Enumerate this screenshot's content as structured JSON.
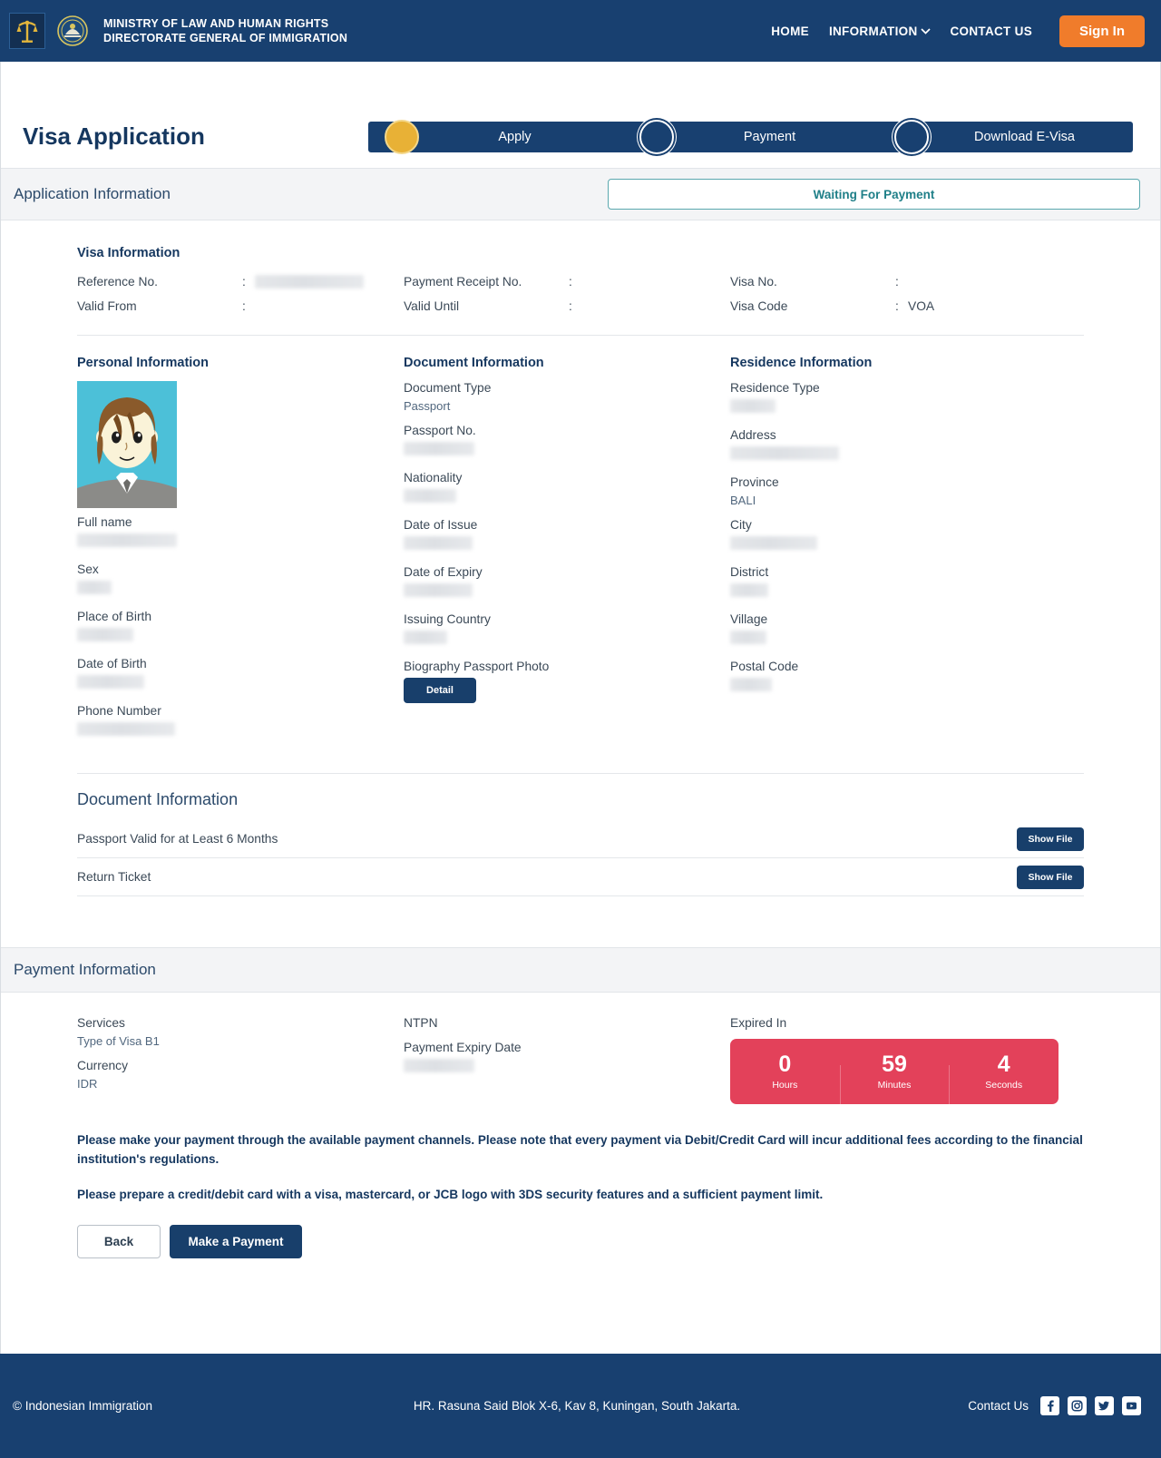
{
  "header": {
    "ministry_line1": "MINISTRY OF  LAW  AND HUMAN RIGHTS",
    "ministry_line2": "DIRECTORATE GENERAL OF IMMIGRATION",
    "nav": [
      {
        "label": "HOME"
      },
      {
        "label": "INFORMATION"
      },
      {
        "label": "CONTACT US"
      }
    ],
    "signin_label": "Sign In",
    "brand_color": "#184070",
    "accent_color": "#f07c2b"
  },
  "page_title": "Visa Application",
  "stepper": {
    "steps": [
      {
        "label": "Apply",
        "state": "active"
      },
      {
        "label": "Payment",
        "state": "inactive"
      },
      {
        "label": "Download E-Visa",
        "state": "inactive"
      }
    ],
    "active_color": "#e8b136"
  },
  "application_section": {
    "title": "Application Information",
    "status": "Waiting For Payment",
    "status_color": "#1f7f88"
  },
  "visa_information": {
    "heading": "Visa Information",
    "rows": [
      {
        "label": "Reference No.",
        "colon": ":",
        "value": "",
        "redacted": true,
        "redact_width": 120
      },
      {
        "label": "Payment Receipt No.",
        "colon": ":",
        "value": "",
        "redacted": false
      },
      {
        "label": "Visa No.",
        "colon": ":",
        "value": "",
        "redacted": false
      },
      {
        "label": "Valid From",
        "colon": ":",
        "value": "",
        "redacted": false
      },
      {
        "label": "Valid Until",
        "colon": ":",
        "value": "",
        "redacted": false
      },
      {
        "label": "Visa Code",
        "colon": ":",
        "value": "VOA",
        "redacted": false
      }
    ]
  },
  "personal_information": {
    "heading": "Personal Information",
    "fields": [
      {
        "label": "Full name",
        "value": "",
        "redacted": true,
        "redact_width": 110
      },
      {
        "label": "Sex",
        "value": "",
        "redacted": true,
        "redact_width": 38
      },
      {
        "label": "Place of Birth",
        "value": "",
        "redacted": true,
        "redact_width": 62
      },
      {
        "label": "Date of Birth",
        "value": "",
        "redacted": true,
        "redact_width": 74
      },
      {
        "label": "Phone Number",
        "value": "",
        "redacted": true,
        "redact_width": 108
      }
    ]
  },
  "document_information": {
    "heading": "Document Information",
    "fields": [
      {
        "label": "Document Type",
        "value": "Passport",
        "redacted": false
      },
      {
        "label": "Passport No.",
        "value": "",
        "redacted": true,
        "redact_width": 78
      },
      {
        "label": "Nationality",
        "value": "",
        "redacted": true,
        "redact_width": 58
      },
      {
        "label": "Date of Issue",
        "value": "",
        "redacted": true,
        "redact_width": 76
      },
      {
        "label": "Date of Expiry",
        "value": "",
        "redacted": true,
        "redact_width": 76
      },
      {
        "label": "Issuing Country",
        "value": "",
        "redacted": true,
        "redact_width": 48
      },
      {
        "label": "Biography Passport Photo",
        "value": "",
        "redacted": false
      }
    ],
    "detail_button": "Detail"
  },
  "residence_information": {
    "heading": "Residence Information",
    "fields": [
      {
        "label": "Residence Type",
        "value": "",
        "redacted": true,
        "redact_width": 50
      },
      {
        "label": "Address",
        "value": "",
        "redacted": true,
        "redact_width": 120
      },
      {
        "label": "Province",
        "value": "BALI",
        "redacted": false
      },
      {
        "label": "City",
        "value": "",
        "redacted": true,
        "redact_width": 96
      },
      {
        "label": "District",
        "value": "",
        "redacted": true,
        "redact_width": 42
      },
      {
        "label": "Village",
        "value": "",
        "redacted": true,
        "redact_width": 40
      },
      {
        "label": "Postal Code",
        "value": "",
        "redacted": true,
        "redact_width": 46
      }
    ]
  },
  "documents_list": {
    "title": "Document Information",
    "rows": [
      {
        "label": "Passport Valid for at Least 6 Months",
        "button": "Show File"
      },
      {
        "label": "Return Ticket",
        "button": "Show File"
      }
    ]
  },
  "payment_information": {
    "title": "Payment Information",
    "fields": [
      {
        "label": "Services",
        "value": "Type of Visa B1",
        "redacted": false
      },
      {
        "label": "Currency",
        "value": "IDR",
        "redacted": false
      },
      {
        "label": "NTPN",
        "value": "",
        "redacted": false
      },
      {
        "label": "Payment Expiry Date",
        "value": "",
        "redacted": true,
        "redact_width": 78
      }
    ],
    "timer": {
      "label": "Expired In",
      "background_color": "#e3415a",
      "units": [
        {
          "value": "0",
          "unit": "Hours"
        },
        {
          "value": "59",
          "unit": "Minutes"
        },
        {
          "value": "4",
          "unit": "Seconds"
        }
      ]
    },
    "notice1": "Please make your payment through the available payment channels. Please note that every payment via Debit/Credit Card will incur additional fees according to the financial institution's regulations.",
    "notice2": "Please prepare a credit/debit card with a visa, mastercard, or JCB logo with 3DS security features and a sufficient payment limit.",
    "back_button": "Back",
    "pay_button": "Make a Payment"
  },
  "footer": {
    "copyright": "© Indonesian Immigration",
    "address": "HR. Rasuna Said Blok X-6, Kav 8, Kuningan, South Jakarta.",
    "contact_label": "Contact Us",
    "socials": [
      "facebook-icon",
      "instagram-icon",
      "twitter-icon",
      "youtube-icon"
    ]
  }
}
